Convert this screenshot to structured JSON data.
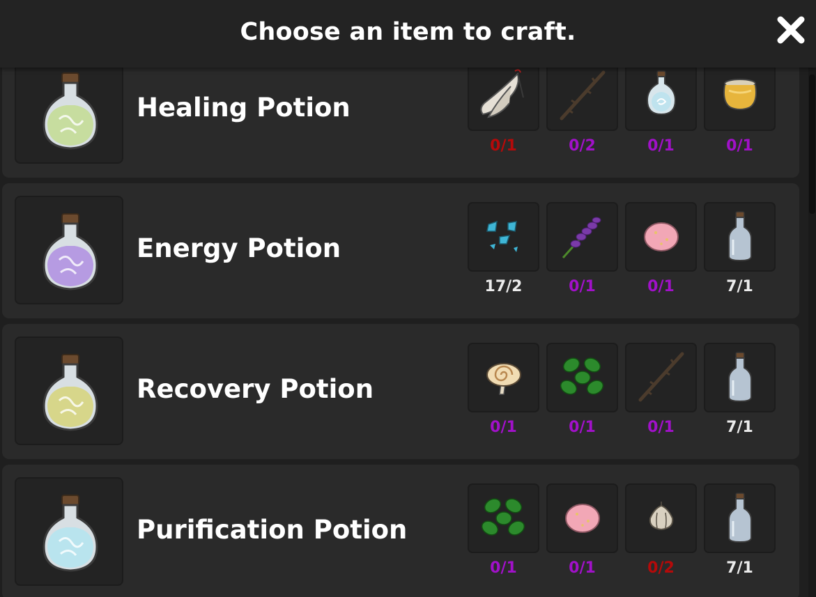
{
  "header": {
    "title": "Choose an item to craft."
  },
  "close_icon": "close-icon",
  "colors": {
    "lacking": "#a111c9",
    "missing": "#b50a0a",
    "have": "#ececec"
  },
  "recipes": [
    {
      "name": "Healing Potion",
      "icon": "potion-flask-green",
      "ingredients": [
        {
          "icon": "feather-bundle",
          "count": "0/1",
          "status": "missing"
        },
        {
          "icon": "thorny-twig",
          "count": "0/2",
          "status": "lacking"
        },
        {
          "icon": "small-potion-blue",
          "count": "0/1",
          "status": "lacking"
        },
        {
          "icon": "honey-jar",
          "count": "0/1",
          "status": "lacking"
        }
      ]
    },
    {
      "name": "Energy Potion",
      "icon": "potion-flask-purple",
      "ingredients": [
        {
          "icon": "blue-crystal-shards",
          "count": "17/2",
          "status": "have"
        },
        {
          "icon": "lavender-sprig",
          "count": "0/1",
          "status": "lacking"
        },
        {
          "icon": "pink-stone",
          "count": "0/1",
          "status": "lacking"
        },
        {
          "icon": "empty-bottle",
          "count": "7/1",
          "status": "have"
        }
      ]
    },
    {
      "name": "Recovery Potion",
      "icon": "potion-flask-yellow",
      "ingredients": [
        {
          "icon": "swirl-mushroom",
          "count": "0/1",
          "status": "lacking"
        },
        {
          "icon": "green-leaves",
          "count": "0/1",
          "status": "lacking"
        },
        {
          "icon": "thorny-twig",
          "count": "0/1",
          "status": "lacking"
        },
        {
          "icon": "empty-bottle",
          "count": "7/1",
          "status": "have"
        }
      ]
    },
    {
      "name": "Purification Potion",
      "icon": "potion-flask-cyan",
      "ingredients": [
        {
          "icon": "green-leaves",
          "count": "0/1",
          "status": "lacking"
        },
        {
          "icon": "pink-stone",
          "count": "0/1",
          "status": "lacking"
        },
        {
          "icon": "garlic-bulb",
          "count": "0/2",
          "status": "missing"
        },
        {
          "icon": "empty-bottle",
          "count": "7/1",
          "status": "have"
        }
      ]
    }
  ]
}
